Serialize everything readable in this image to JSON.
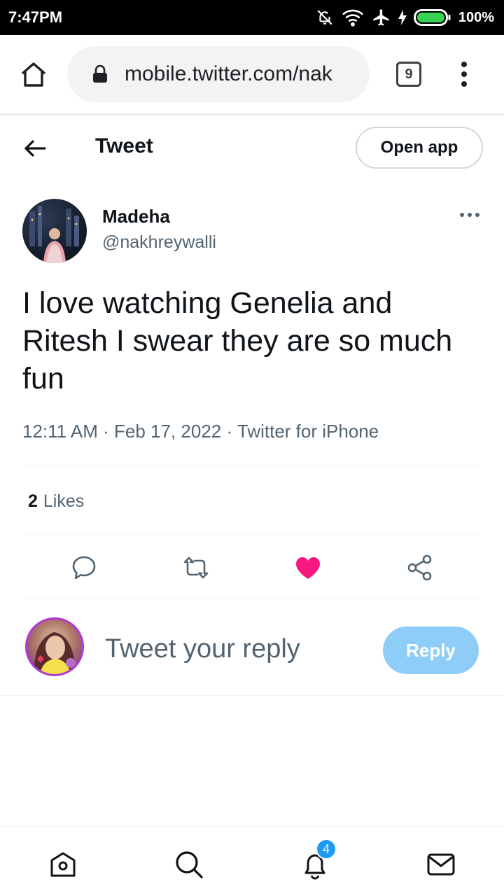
{
  "status_bar": {
    "time": "7:47PM",
    "battery_percent": "100%",
    "icons": [
      "notifications-off-icon",
      "wifi-icon",
      "airplane-mode-icon",
      "charging-icon",
      "battery-icon"
    ]
  },
  "browser": {
    "url": "mobile.twitter.com/nak",
    "tab_count": "9"
  },
  "header": {
    "title": "Tweet",
    "open_app_label": "Open app"
  },
  "tweet": {
    "author_name": "Madeha",
    "author_handle": "@nakhreywalli",
    "text": "I love watching Genelia and Ritesh I swear they are so much fun",
    "meta": "12:11 AM · Feb 17, 2022 · Twitter for iPhone",
    "likes_count": "2",
    "likes_label": "Likes",
    "liked": true
  },
  "reply": {
    "placeholder": "Tweet your reply",
    "button_label": "Reply"
  },
  "bottom_nav": {
    "items": [
      "home",
      "explore",
      "notifications",
      "messages"
    ],
    "notification_badge": "4"
  },
  "colors": {
    "accent": "#1d9bf0",
    "like": "#f91880",
    "reply_button_disabled": "#8ecdf8",
    "secondary_text": "#536471"
  }
}
